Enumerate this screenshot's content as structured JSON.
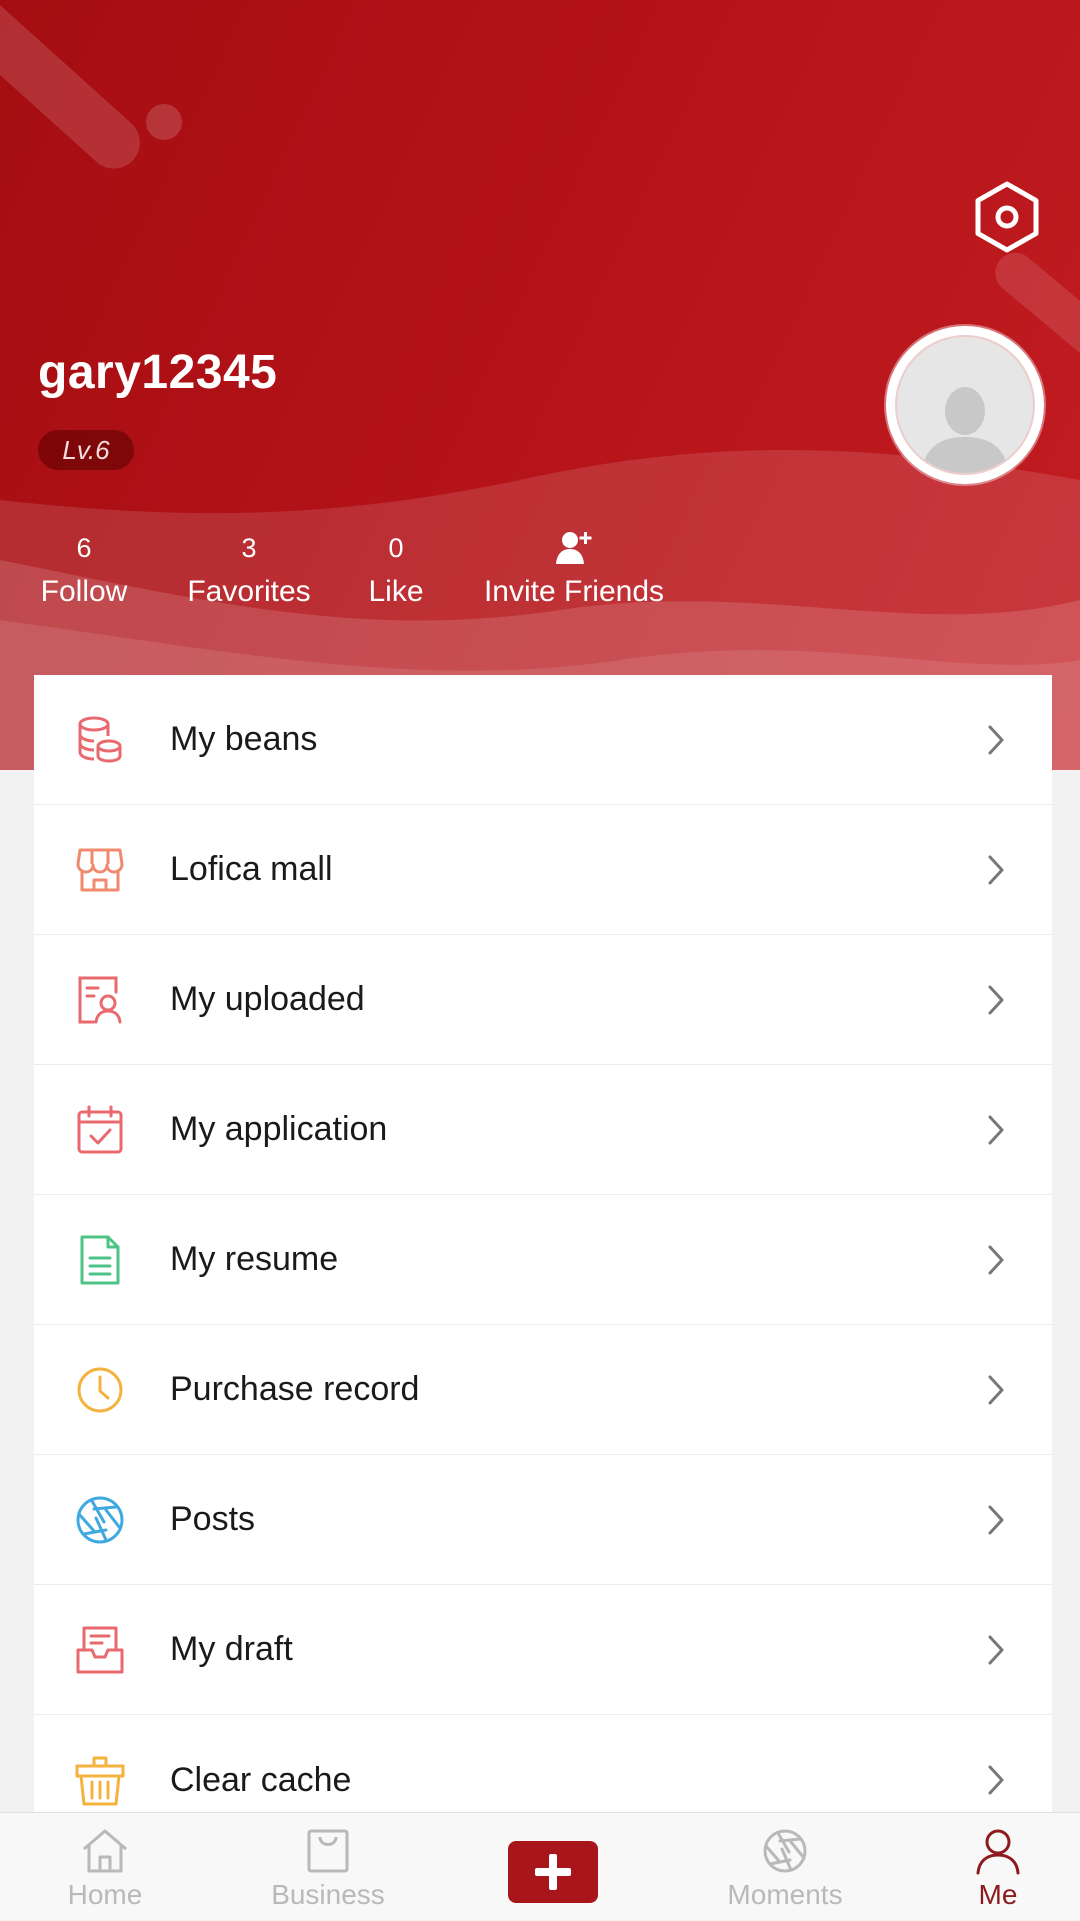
{
  "colors": {
    "brand_red": "#a8161b",
    "header_gradient_start": "#a50d12",
    "header_gradient_end": "#c21d22",
    "tab_active": "#8e1a1e",
    "tab_inactive": "#b9b9b9"
  },
  "profile": {
    "username": "gary12345",
    "level": "Lv.6",
    "avatar_icon": "default-avatar-icon",
    "settings_icon": "hexagon-settings-icon"
  },
  "stats": {
    "follow": {
      "value": "6",
      "label": "Follow"
    },
    "favorites": {
      "value": "3",
      "label": "Favorites"
    },
    "like": {
      "value": "0",
      "label": "Like"
    },
    "invite": {
      "label": "Invite Friends",
      "icon": "add-user-icon"
    }
  },
  "menu": {
    "items": [
      {
        "label": "My beans",
        "icon": "coin-stack-icon"
      },
      {
        "label": "Lofica mall",
        "icon": "store-icon"
      },
      {
        "label": "My uploaded",
        "icon": "user-document-icon"
      },
      {
        "label": "My application",
        "icon": "calendar-check-icon"
      },
      {
        "label": "My resume",
        "icon": "document-icon"
      },
      {
        "label": "Purchase record",
        "icon": "clock-icon"
      },
      {
        "label": "Posts",
        "icon": "aperture-icon"
      },
      {
        "label": "My draft",
        "icon": "draft-box-icon"
      },
      {
        "label": "Clear cache",
        "icon": "trash-basket-icon"
      }
    ]
  },
  "tabbar": {
    "home": "Home",
    "business": "Business",
    "moments": "Moments",
    "me": "Me",
    "active": "Me"
  }
}
